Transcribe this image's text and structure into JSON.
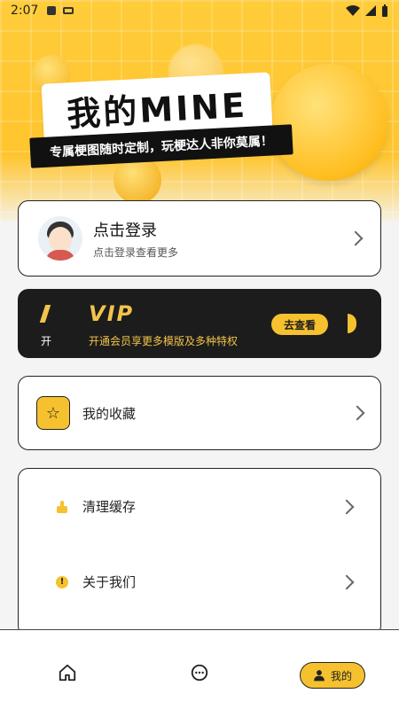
{
  "status_bar": {
    "time": "2:07",
    "icons": [
      "a-icon",
      "keyboard-icon",
      "wifi-icon",
      "signal-icon",
      "battery-icon"
    ]
  },
  "hero": {
    "title": "我的MINE",
    "tagline": "专属梗图随时定制，玩梗达人非你莫属！"
  },
  "login": {
    "title": "点击登录",
    "subtitle": "点击登录查看更多"
  },
  "vip": {
    "open_label": "开",
    "logo": "VIP",
    "description": "开通会员享更多模版及多种特权",
    "button": "去查看"
  },
  "favorites": {
    "label": "我的收藏"
  },
  "menu": [
    {
      "label": "清理缓存",
      "icon": "broom-icon"
    },
    {
      "label": "关于我们",
      "icon": "info-icon"
    }
  ],
  "bottom_nav": {
    "items": [
      {
        "name": "home",
        "icon": "home-icon"
      },
      {
        "name": "chat",
        "icon": "chat-icon"
      },
      {
        "name": "mine",
        "icon": "user-icon",
        "label": "我的"
      }
    ]
  },
  "colors": {
    "accent": "#f6c12e",
    "dark": "#1c1c1c"
  }
}
